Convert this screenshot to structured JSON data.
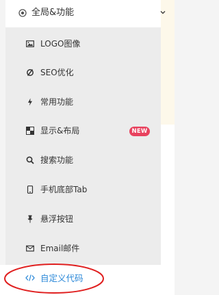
{
  "menu": {
    "header": {
      "label": "全局&功能",
      "icon": "radio-target-icon",
      "chevron": "chevron-down-icon"
    },
    "items": [
      {
        "label": "LOGO图像",
        "icon": "image-icon"
      },
      {
        "label": "SEO优化",
        "icon": "seo-icon"
      },
      {
        "label": "常用功能",
        "icon": "lightning-icon"
      },
      {
        "label": "显示&布局",
        "icon": "layout-grid-icon",
        "badge": "NEW"
      },
      {
        "label": "搜索功能",
        "icon": "search-icon"
      },
      {
        "label": "手机底部Tab",
        "icon": "mobile-icon"
      },
      {
        "label": "悬浮按钮",
        "icon": "pin-icon"
      },
      {
        "label": "Email邮件",
        "icon": "mail-icon"
      }
    ],
    "custom_code": {
      "label": "自定义代码",
      "icon": "code-icon"
    }
  },
  "colors": {
    "link_blue": "#2b88d8",
    "badge_red": "#e8425e",
    "annotation_red": "#e02020",
    "menu_bg": "#ececec"
  }
}
